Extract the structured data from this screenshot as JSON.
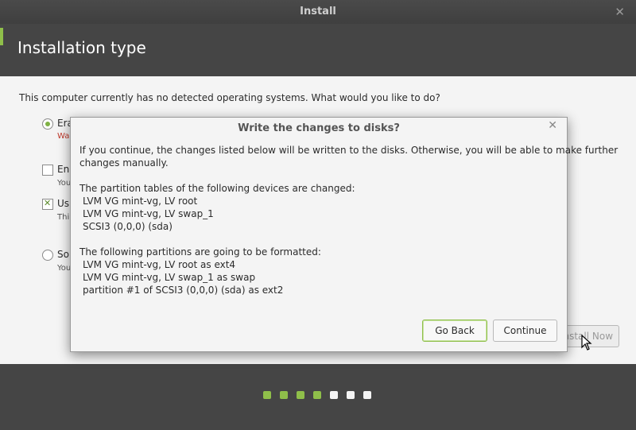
{
  "window": {
    "title": "Install",
    "close_glyph": "✕"
  },
  "header": {
    "title": "Installation type"
  },
  "content": {
    "question": "This computer currently has no detected operating systems. What would you like to do?",
    "options": [
      {
        "label": "Era",
        "sub": "Wa",
        "selected": true
      },
      {
        "label": "En",
        "sub": "You",
        "checked": false
      },
      {
        "label": "Us",
        "sub": "Thi",
        "checked": true
      },
      {
        "label": "So",
        "sub": "You",
        "selected": false
      }
    ],
    "install_now": "Install Now"
  },
  "dialog": {
    "title": "Write the changes to disks?",
    "close_glyph": "✕",
    "intro_1": "If you continue, the changes listed below will be written to the disks. Otherwise, you will be able to make further",
    "intro_2": "changes manually.",
    "partition_header": "The partition tables of the following devices are changed:",
    "partition_devices": [
      "LVM VG mint-vg, LV root",
      "LVM VG mint-vg, LV swap_1",
      "SCSI3 (0,0,0) (sda)"
    ],
    "format_header": "The following partitions are going to be formatted:",
    "format_items": [
      "LVM VG mint-vg, LV root as ext4",
      "LVM VG mint-vg, LV swap_1 as swap",
      "partition #1 of SCSI3 (0,0,0) (sda) as ext2"
    ],
    "go_back": "Go Back",
    "continue": "Continue"
  },
  "progress": {
    "total_steps": 7,
    "completed_steps": 4
  },
  "colors": {
    "accent": "#8fbf4a",
    "header_bg": "#454545",
    "content_bg": "#f4f4f4"
  }
}
